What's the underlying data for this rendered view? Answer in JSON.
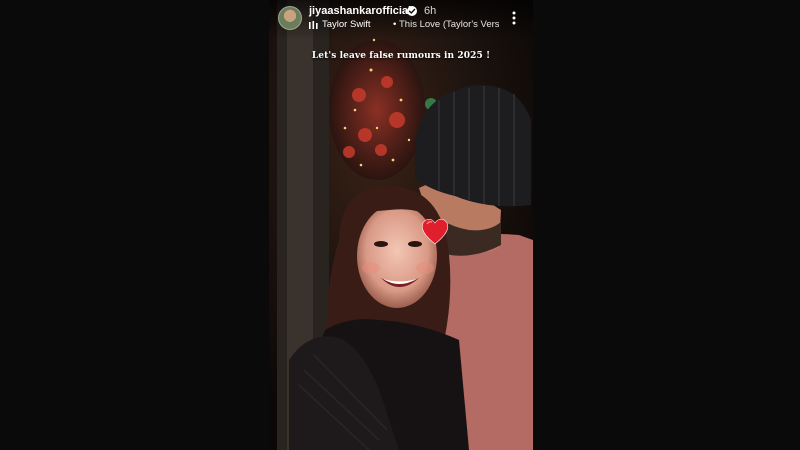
{
  "story": {
    "username": "jiyaashankarofficial",
    "time_ago": "6h",
    "music": {
      "artist": "Taylor Swift",
      "separator": "•",
      "song": "This Love (Taylor's Versio..."
    },
    "caption": "Let's leave false rumours in 2025 !",
    "icons": {
      "avatar": "profile-avatar",
      "verified": "verified-badge-icon",
      "music": "music-bars-icon",
      "more": "more-options-icon",
      "sticker": "red-heart-sticker"
    }
  }
}
